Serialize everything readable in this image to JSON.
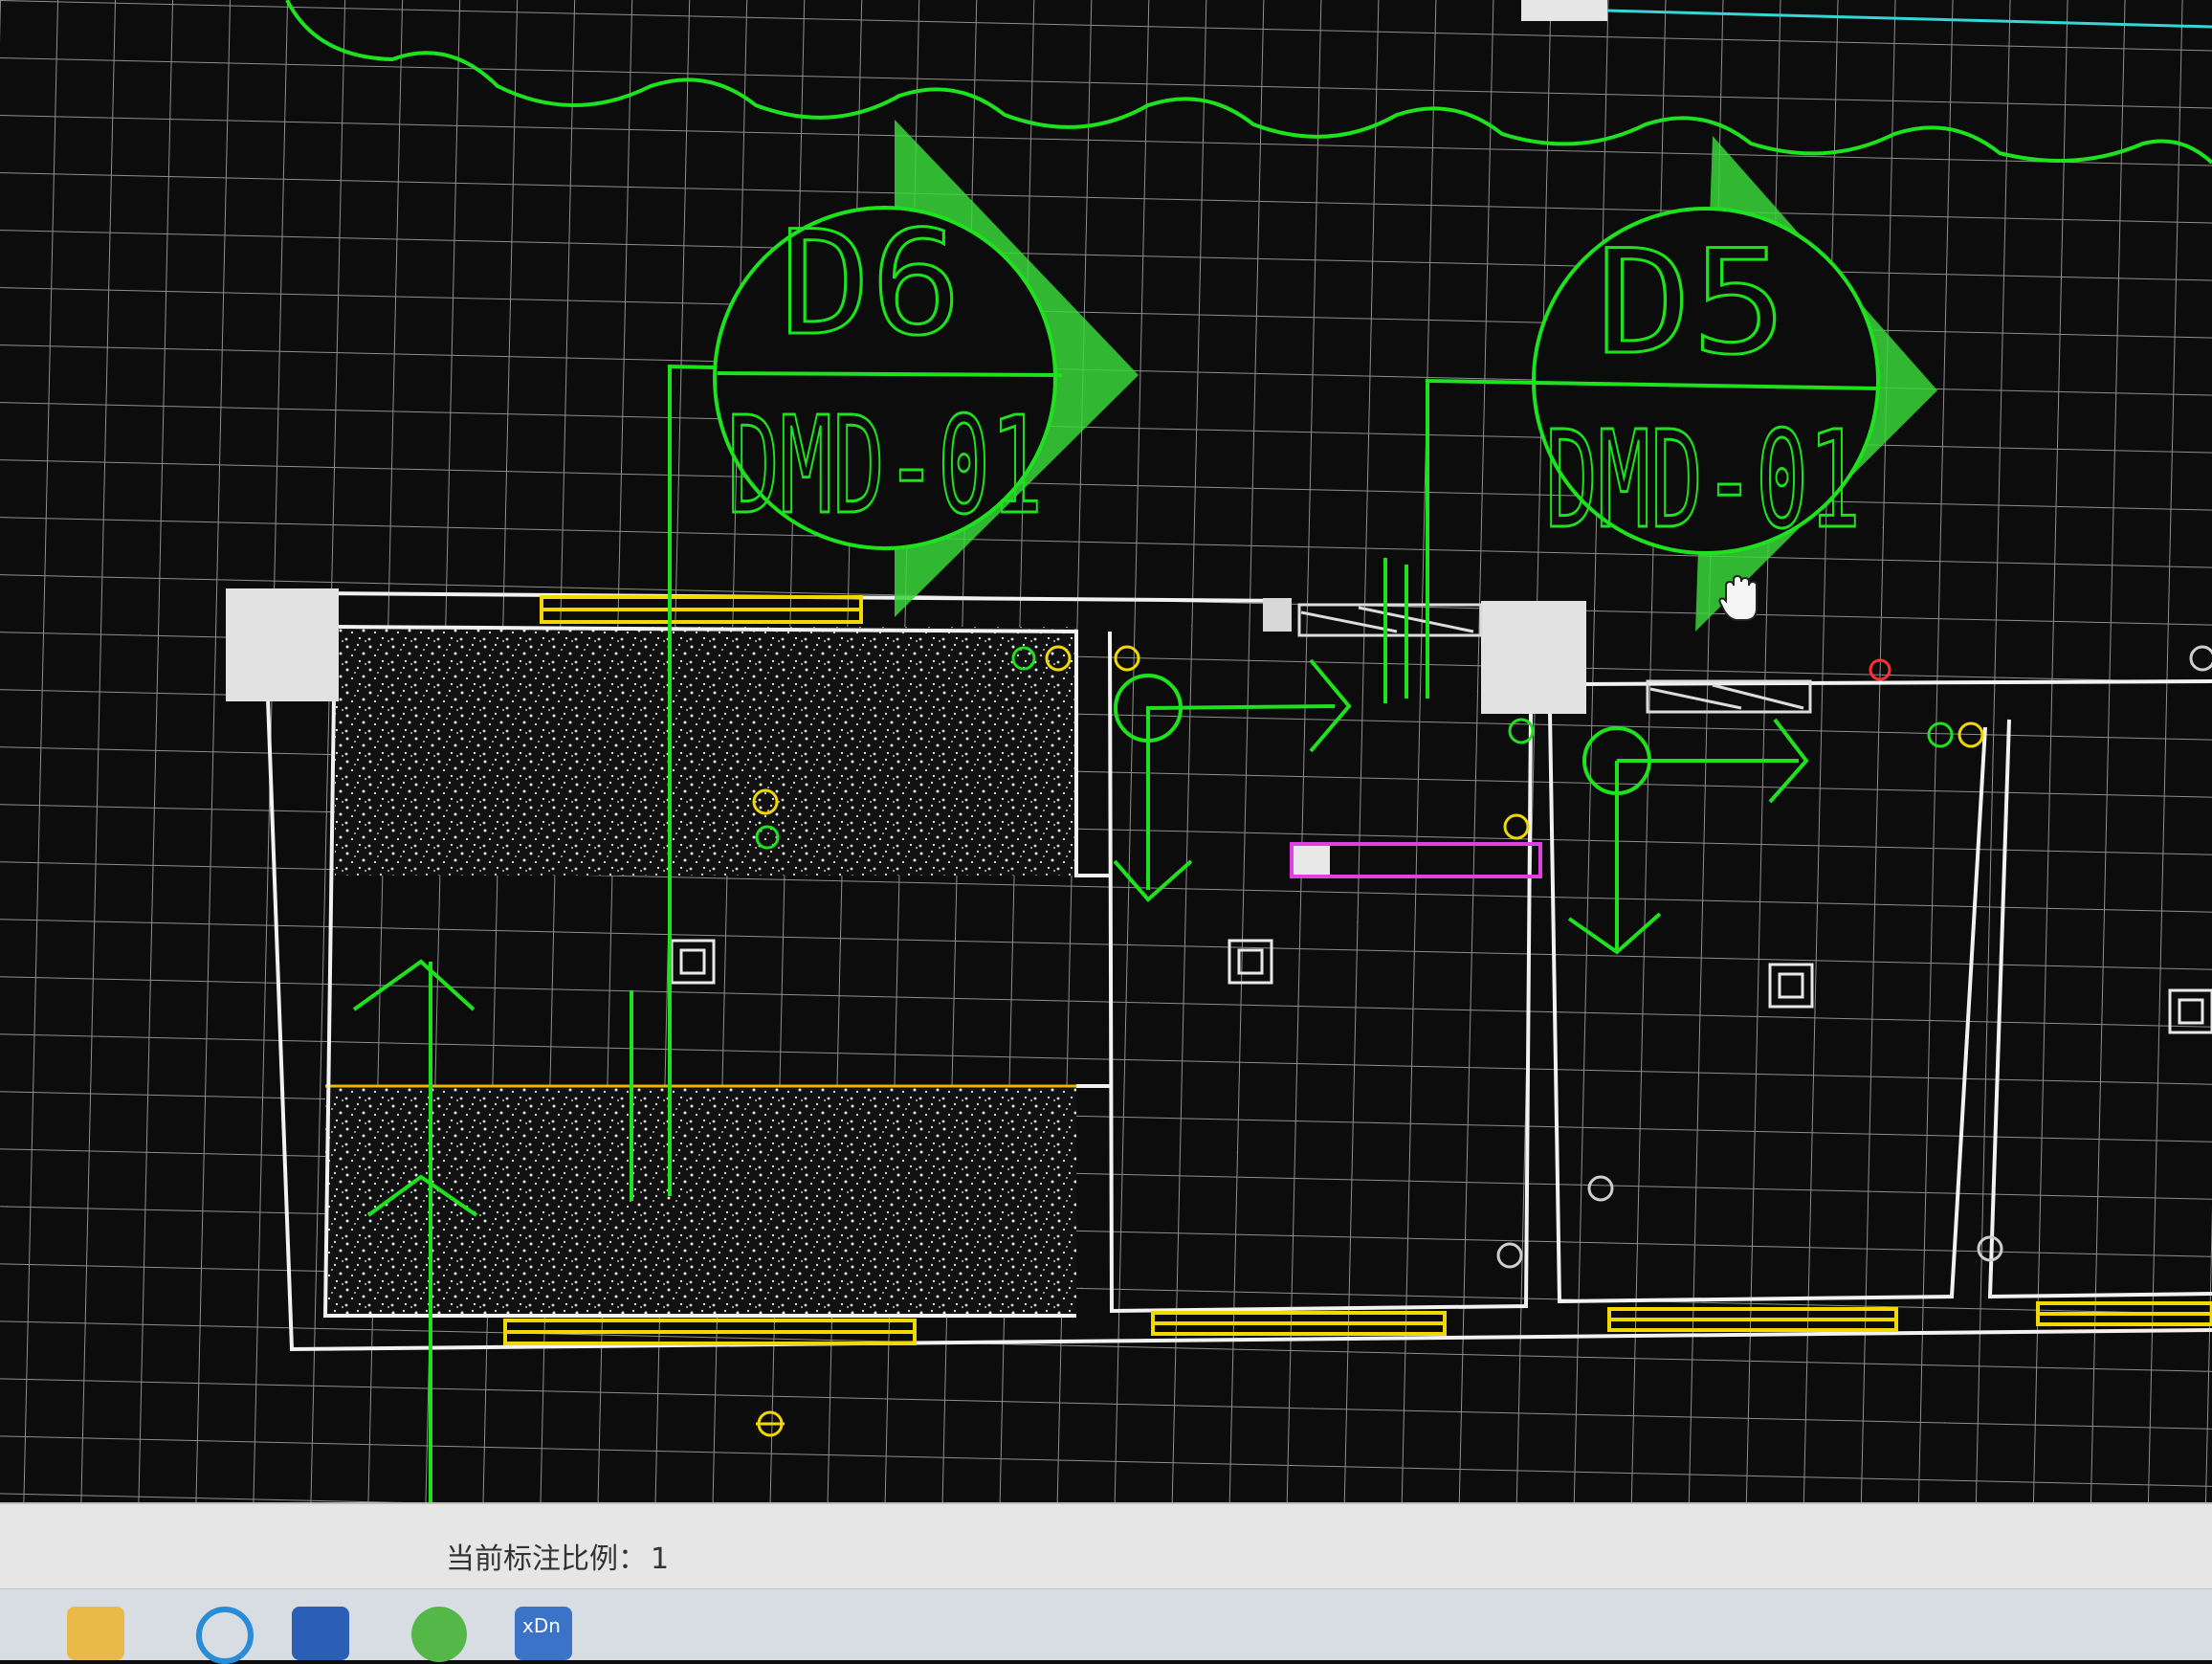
{
  "drawing": {
    "labels": [
      {
        "name": "d6",
        "top": "D6",
        "bottom": "DMD-01"
      },
      {
        "name": "d5",
        "top": "D5",
        "bottom": "DMD-01"
      }
    ],
    "colors": {
      "background": "#0c0c0c",
      "grid": "#8e8e8e",
      "wall": "#f2f2f2",
      "annotation": "#1ee21e",
      "yellow": "#f0d800",
      "magenta": "#e040e0",
      "red": "#ff3030",
      "column": "#e2e2e2"
    }
  },
  "status_bar": {
    "scale_label": "当前标注比例：",
    "scale_value": "1"
  },
  "taskbar": {
    "icons": [
      "folder-icon",
      "search-icon",
      "word-icon",
      "green-app-icon",
      "app-icon"
    ],
    "app_badge": "xDn"
  }
}
